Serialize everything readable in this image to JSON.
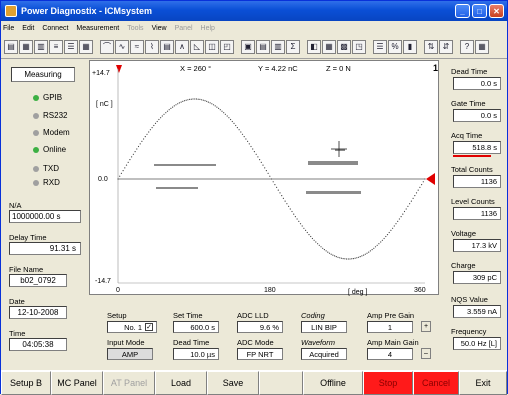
{
  "window": {
    "title": "Power Diagnostix - ICMsystem"
  },
  "menu": [
    "File",
    "Edit",
    "Connect",
    "Measurement",
    "Tools",
    "View",
    "Panel",
    "Help"
  ],
  "left": {
    "mode_button": "Measuring",
    "indicators": [
      {
        "label": "GPIB",
        "color": "#3cb043"
      },
      {
        "label": "RS232",
        "color": "#a0a0a0"
      },
      {
        "label": "Modem",
        "color": "#a0a0a0"
      },
      {
        "label": "Online",
        "color": "#3cb043"
      },
      {
        "label": "TXD",
        "color": "#a0a0a0"
      },
      {
        "label": "RXD",
        "color": "#a0a0a0"
      }
    ],
    "na_label": "N/A",
    "na_value": "1000000.00  s",
    "delay_label": "Delay Time",
    "delay_value": "91.31  s",
    "file_label": "File Name",
    "file_value": "b02_0792",
    "date_label": "Date",
    "date_value": "12-10-2008",
    "time_label": "Time",
    "time_value": "04:05:38"
  },
  "plot": {
    "x_readout": "X = 260 °",
    "y_readout": "Y = 4.22 nC",
    "z_readout": "Z =  0 N",
    "channel": "1",
    "y_max": "+14.7",
    "y_unit": "[ nC ]",
    "y_zero": "0.0",
    "y_min": "-14.7",
    "x_min": "0",
    "x_mid": "180",
    "x_unit": "[ deg ]",
    "x_max": "360"
  },
  "right": [
    {
      "label": "Dead Time",
      "value": "0.0 s"
    },
    {
      "label": "Gate Time",
      "value": "0.0 s"
    },
    {
      "label": "Acq Time",
      "value": "518.8 s"
    },
    {
      "label": "Total Counts",
      "value": "1136"
    },
    {
      "label": "Level Counts",
      "value": "1136"
    },
    {
      "label": "Voltage",
      "value": "17.3 kV"
    },
    {
      "label": "Charge",
      "value": "309 pC"
    },
    {
      "label": "NQS Value",
      "value": "3.559 nA"
    },
    {
      "label": "Frequency",
      "value": "50.0 Hz [L]"
    }
  ],
  "acq_progress": 0.8,
  "controls": {
    "setup_label": "Setup",
    "setup_value": "No. 1",
    "settime_label": "Set Time",
    "settime_value": "600.0 s",
    "adclld_label": "ADC LLD",
    "adclld_value": "9.6 %",
    "coding_label": "Coding",
    "coding_value": "LIN BIP",
    "apg_label": "Amp Pre Gain",
    "apg_value": "1",
    "input_label": "Input Mode",
    "input_value": "AMP",
    "dead_label": "Dead Time",
    "dead_value": "10.0 µs",
    "adcmode_label": "ADC Mode",
    "adcmode_value": "FP NRT",
    "wave_label": "Waveform",
    "wave_value": "Acquired",
    "amg_label": "Amp Main Gain",
    "amg_value": "4",
    "plus": "+",
    "minus": "–"
  },
  "bottom": [
    "Setup B",
    "MC Panel",
    "AT Panel",
    "Load",
    "Save",
    "",
    "Offline",
    "Stop",
    "Cancel",
    "Exit"
  ]
}
